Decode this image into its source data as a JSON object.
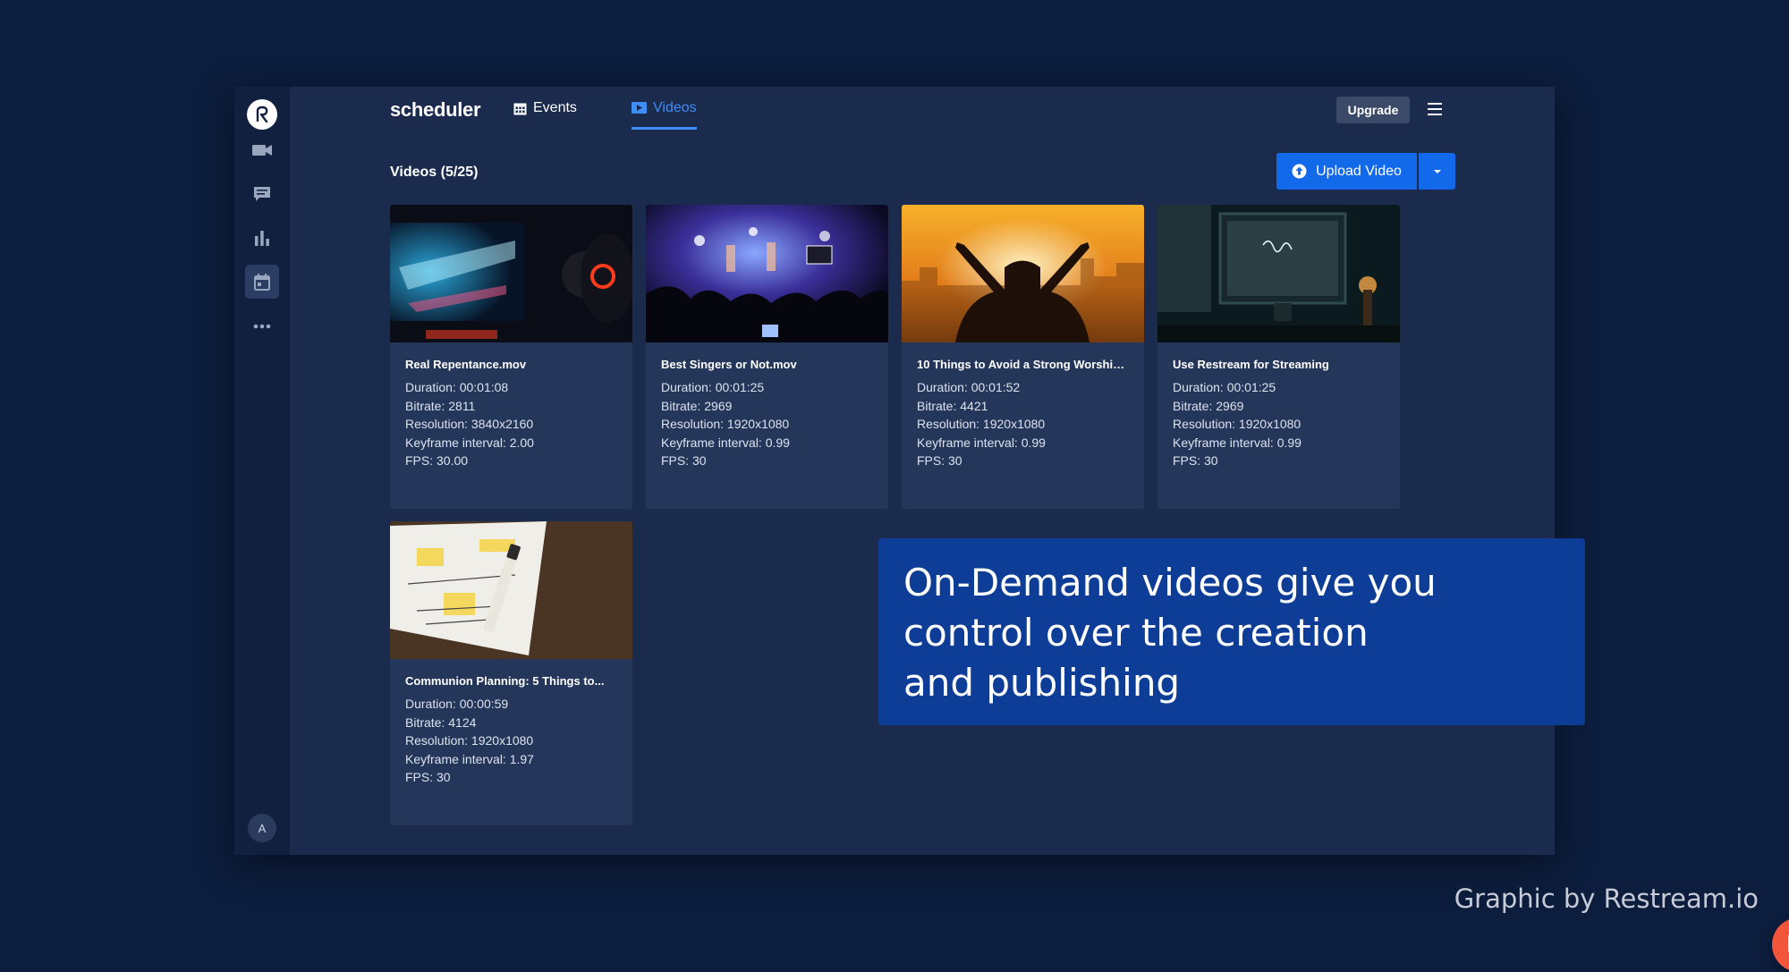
{
  "app": {
    "brand": "scheduler",
    "tabs": [
      {
        "label": "Events",
        "icon": "calendar-icon",
        "active": false
      },
      {
        "label": "Videos",
        "icon": "video-icon",
        "active": true
      }
    ],
    "upgrade_label": "Upgrade",
    "avatar_initial": "A"
  },
  "sidebar": {
    "items": [
      {
        "name": "video-camera-icon"
      },
      {
        "name": "chat-icon"
      },
      {
        "name": "analytics-icon"
      },
      {
        "name": "scheduler-icon",
        "active": true
      },
      {
        "name": "more-icon"
      }
    ]
  },
  "main": {
    "title": "Videos (5/25)",
    "upload_label": "Upload Video"
  },
  "videos": [
    {
      "title": "Real Repentance.mov",
      "duration": "Duration: 00:01:08",
      "bitrate": "Bitrate: 2811",
      "resolution": "Resolution: 3840x2160",
      "keyframe": "Keyframe interval: 2.00",
      "fps": "FPS: 30.00"
    },
    {
      "title": "Best Singers or Not.mov",
      "duration": "Duration: 00:01:25",
      "bitrate": "Bitrate: 2969",
      "resolution": "Resolution: 1920x1080",
      "keyframe": "Keyframe interval: 0.99",
      "fps": "FPS: 30"
    },
    {
      "title": "10 Things to Avoid a Strong Worship...",
      "duration": "Duration: 00:01:52",
      "bitrate": "Bitrate: 4421",
      "resolution": "Resolution: 1920x1080",
      "keyframe": "Keyframe interval: 0.99",
      "fps": "FPS: 30"
    },
    {
      "title": "Use Restream for Streaming",
      "duration": "Duration: 00:01:25",
      "bitrate": "Bitrate: 2969",
      "resolution": "Resolution: 1920x1080",
      "keyframe": "Keyframe interval: 0.99",
      "fps": "FPS: 30"
    },
    {
      "title": "Communion Planning: 5 Things to...",
      "duration": "Duration: 00:00:59",
      "bitrate": "Bitrate: 4124",
      "resolution": "Resolution: 1920x1080",
      "keyframe": "Keyframe interval: 1.97",
      "fps": "FPS: 30"
    }
  ],
  "banner": {
    "line1": "On-Demand videos give you",
    "line2": "control over the creation",
    "line3": "and publishing"
  },
  "credit": "Graphic by Restream.io",
  "colors": {
    "background": "#0c1d3d",
    "panel": "#1a2b4e",
    "accent": "#1269ea",
    "active_tab": "#3d8ef7",
    "banner": "#0d3d96",
    "chat": "#f2553a"
  }
}
